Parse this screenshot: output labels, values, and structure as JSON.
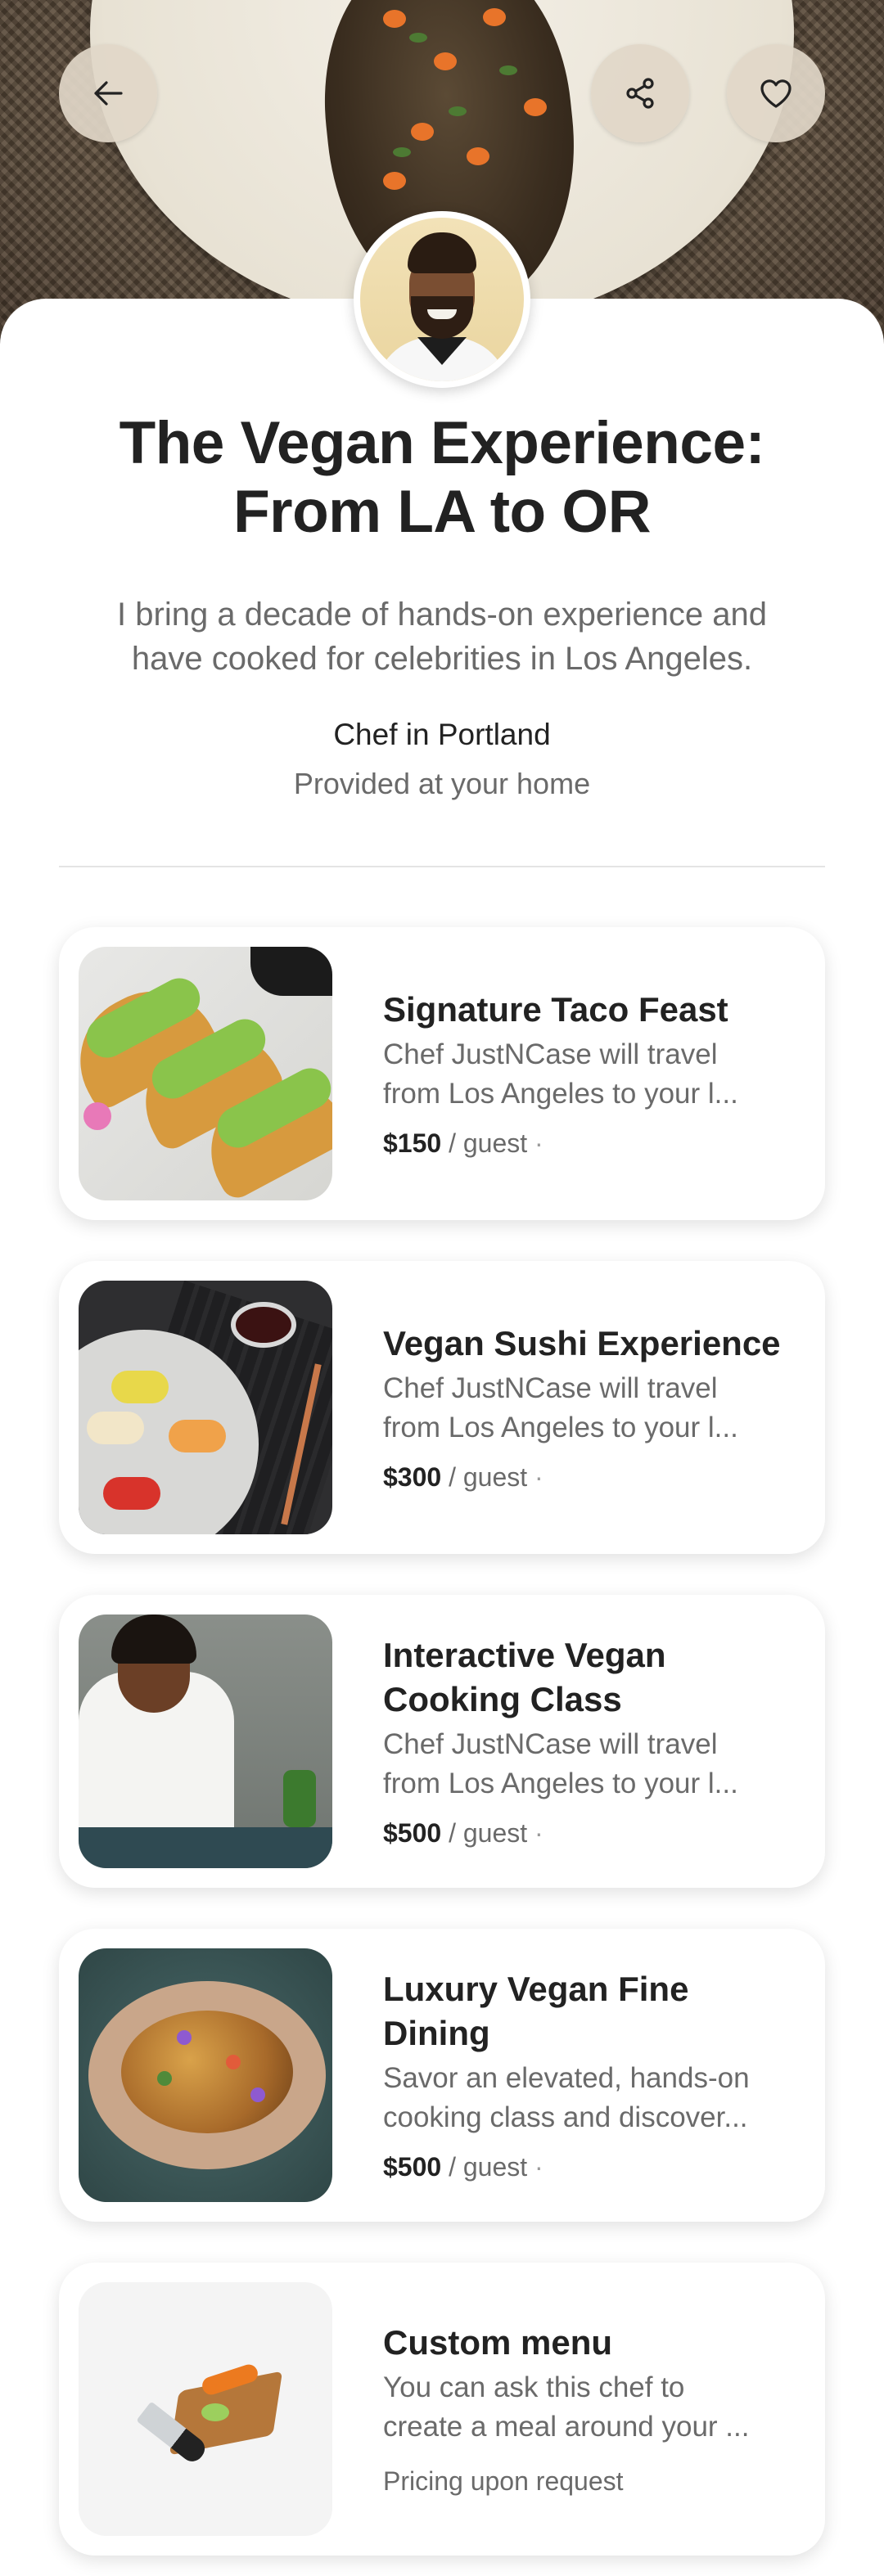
{
  "header": {
    "back_icon": "arrow-left-icon",
    "share_icon": "share-icon",
    "favorite_icon": "heart-icon"
  },
  "experience": {
    "title_line1": "The Vegan Experience:",
    "title_line2": "From LA to OR",
    "description_line1": "I bring a decade of hands-on experience and",
    "description_line2": "have cooked for celebrities in Los Angeles.",
    "role": "Chef in Portland",
    "location": "Provided at your home"
  },
  "menu": [
    {
      "title_lines": [
        "Signature Taco Feast"
      ],
      "desc_line1": "Chef JustNCase will travel",
      "desc_line2": "from Los Angeles to your l...",
      "price": "$150",
      "per": " / guest",
      "dot": " ·"
    },
    {
      "title_lines": [
        "Vegan Sushi Experience"
      ],
      "desc_line1": "Chef JustNCase will travel",
      "desc_line2": "from Los Angeles to your l...",
      "price": "$300",
      "per": " / guest",
      "dot": " ·"
    },
    {
      "title_lines": [
        "Interactive Vegan",
        "Cooking Class"
      ],
      "desc_line1": "Chef JustNCase will travel",
      "desc_line2": "from Los Angeles to your l...",
      "price": "$500",
      "per": " / guest",
      "dot": " ·"
    },
    {
      "title_lines": [
        "Luxury Vegan Fine",
        "Dining"
      ],
      "desc_line1": "Savor an elevated, hands-on",
      "desc_line2": "cooking class and discover...",
      "price": "$500",
      "per": " / guest",
      "dot": " ·"
    },
    {
      "title_lines": [
        "Custom menu"
      ],
      "desc_line1": "You can ask this chef to",
      "desc_line2": "create a meal around your ...",
      "pricing_note": "Pricing upon request"
    }
  ]
}
